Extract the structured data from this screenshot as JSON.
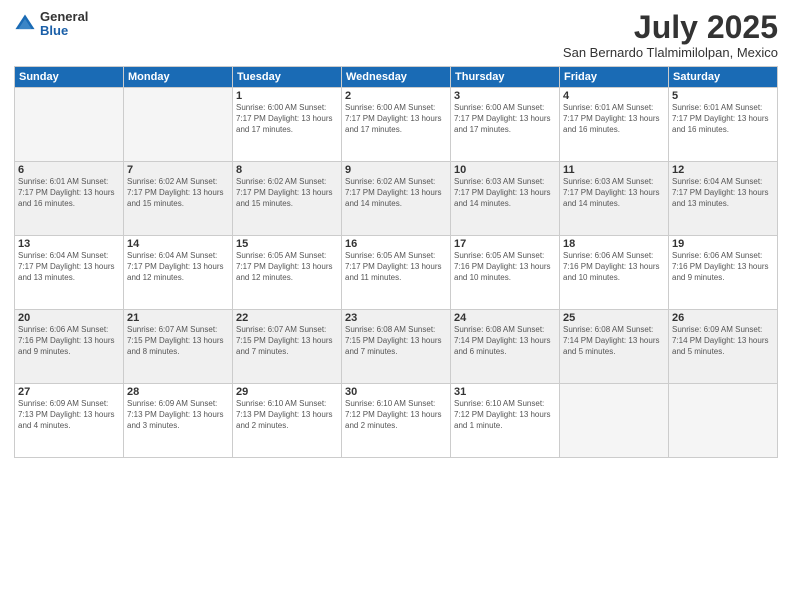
{
  "logo": {
    "general": "General",
    "blue": "Blue"
  },
  "title": "July 2025",
  "subtitle": "San Bernardo Tlalmimilolpan, Mexico",
  "weekdays": [
    "Sunday",
    "Monday",
    "Tuesday",
    "Wednesday",
    "Thursday",
    "Friday",
    "Saturday"
  ],
  "weeks": [
    [
      {
        "day": "",
        "info": ""
      },
      {
        "day": "",
        "info": ""
      },
      {
        "day": "1",
        "info": "Sunrise: 6:00 AM\nSunset: 7:17 PM\nDaylight: 13 hours\nand 17 minutes."
      },
      {
        "day": "2",
        "info": "Sunrise: 6:00 AM\nSunset: 7:17 PM\nDaylight: 13 hours\nand 17 minutes."
      },
      {
        "day": "3",
        "info": "Sunrise: 6:00 AM\nSunset: 7:17 PM\nDaylight: 13 hours\nand 17 minutes."
      },
      {
        "day": "4",
        "info": "Sunrise: 6:01 AM\nSunset: 7:17 PM\nDaylight: 13 hours\nand 16 minutes."
      },
      {
        "day": "5",
        "info": "Sunrise: 6:01 AM\nSunset: 7:17 PM\nDaylight: 13 hours\nand 16 minutes."
      }
    ],
    [
      {
        "day": "6",
        "info": "Sunrise: 6:01 AM\nSunset: 7:17 PM\nDaylight: 13 hours\nand 16 minutes."
      },
      {
        "day": "7",
        "info": "Sunrise: 6:02 AM\nSunset: 7:17 PM\nDaylight: 13 hours\nand 15 minutes."
      },
      {
        "day": "8",
        "info": "Sunrise: 6:02 AM\nSunset: 7:17 PM\nDaylight: 13 hours\nand 15 minutes."
      },
      {
        "day": "9",
        "info": "Sunrise: 6:02 AM\nSunset: 7:17 PM\nDaylight: 13 hours\nand 14 minutes."
      },
      {
        "day": "10",
        "info": "Sunrise: 6:03 AM\nSunset: 7:17 PM\nDaylight: 13 hours\nand 14 minutes."
      },
      {
        "day": "11",
        "info": "Sunrise: 6:03 AM\nSunset: 7:17 PM\nDaylight: 13 hours\nand 14 minutes."
      },
      {
        "day": "12",
        "info": "Sunrise: 6:04 AM\nSunset: 7:17 PM\nDaylight: 13 hours\nand 13 minutes."
      }
    ],
    [
      {
        "day": "13",
        "info": "Sunrise: 6:04 AM\nSunset: 7:17 PM\nDaylight: 13 hours\nand 13 minutes."
      },
      {
        "day": "14",
        "info": "Sunrise: 6:04 AM\nSunset: 7:17 PM\nDaylight: 13 hours\nand 12 minutes."
      },
      {
        "day": "15",
        "info": "Sunrise: 6:05 AM\nSunset: 7:17 PM\nDaylight: 13 hours\nand 12 minutes."
      },
      {
        "day": "16",
        "info": "Sunrise: 6:05 AM\nSunset: 7:17 PM\nDaylight: 13 hours\nand 11 minutes."
      },
      {
        "day": "17",
        "info": "Sunrise: 6:05 AM\nSunset: 7:16 PM\nDaylight: 13 hours\nand 10 minutes."
      },
      {
        "day": "18",
        "info": "Sunrise: 6:06 AM\nSunset: 7:16 PM\nDaylight: 13 hours\nand 10 minutes."
      },
      {
        "day": "19",
        "info": "Sunrise: 6:06 AM\nSunset: 7:16 PM\nDaylight: 13 hours\nand 9 minutes."
      }
    ],
    [
      {
        "day": "20",
        "info": "Sunrise: 6:06 AM\nSunset: 7:16 PM\nDaylight: 13 hours\nand 9 minutes."
      },
      {
        "day": "21",
        "info": "Sunrise: 6:07 AM\nSunset: 7:15 PM\nDaylight: 13 hours\nand 8 minutes."
      },
      {
        "day": "22",
        "info": "Sunrise: 6:07 AM\nSunset: 7:15 PM\nDaylight: 13 hours\nand 7 minutes."
      },
      {
        "day": "23",
        "info": "Sunrise: 6:08 AM\nSunset: 7:15 PM\nDaylight: 13 hours\nand 7 minutes."
      },
      {
        "day": "24",
        "info": "Sunrise: 6:08 AM\nSunset: 7:14 PM\nDaylight: 13 hours\nand 6 minutes."
      },
      {
        "day": "25",
        "info": "Sunrise: 6:08 AM\nSunset: 7:14 PM\nDaylight: 13 hours\nand 5 minutes."
      },
      {
        "day": "26",
        "info": "Sunrise: 6:09 AM\nSunset: 7:14 PM\nDaylight: 13 hours\nand 5 minutes."
      }
    ],
    [
      {
        "day": "27",
        "info": "Sunrise: 6:09 AM\nSunset: 7:13 PM\nDaylight: 13 hours\nand 4 minutes."
      },
      {
        "day": "28",
        "info": "Sunrise: 6:09 AM\nSunset: 7:13 PM\nDaylight: 13 hours\nand 3 minutes."
      },
      {
        "day": "29",
        "info": "Sunrise: 6:10 AM\nSunset: 7:13 PM\nDaylight: 13 hours\nand 2 minutes."
      },
      {
        "day": "30",
        "info": "Sunrise: 6:10 AM\nSunset: 7:12 PM\nDaylight: 13 hours\nand 2 minutes."
      },
      {
        "day": "31",
        "info": "Sunrise: 6:10 AM\nSunset: 7:12 PM\nDaylight: 13 hours\nand 1 minute."
      },
      {
        "day": "",
        "info": ""
      },
      {
        "day": "",
        "info": ""
      }
    ]
  ]
}
